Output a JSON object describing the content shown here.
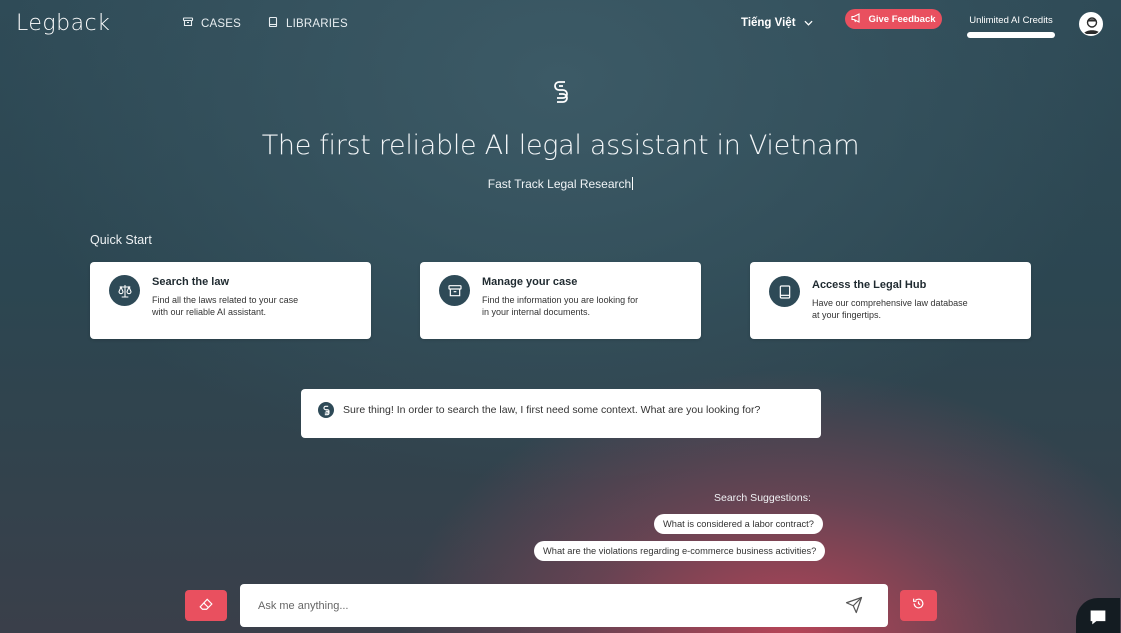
{
  "header": {
    "logo_text": "Legback",
    "nav": [
      {
        "label": "CASES",
        "icon": "archive-icon"
      },
      {
        "label": "LIBRARIES",
        "icon": "book-icon"
      }
    ],
    "language": "Tiếng Việt",
    "feedback_label": "Give Feedback",
    "credits_label": "Unlimited AI Credits",
    "credits_level": 1.0
  },
  "hero": {
    "title": "The first reliable AI legal assistant in Vietnam",
    "subtitle": "Fast Track Legal Research"
  },
  "quick_start": {
    "label": "Quick Start",
    "cards": [
      {
        "title": "Search the law",
        "desc1": "Find all the laws related to your case",
        "desc2": "with our reliable AI assistant.",
        "icon": "scale-icon"
      },
      {
        "title": "Manage your case",
        "desc1": "Find the information you are looking for",
        "desc2": "in your internal documents.",
        "icon": "archive-icon"
      },
      {
        "title": "Access the Legal Hub",
        "desc1": "Have our comprehensive law database",
        "desc2": "at your fingertips.",
        "icon": "book-icon"
      }
    ]
  },
  "chat": {
    "bot_message": "Sure thing! In order to search the law, I first need some context. What are you looking for?"
  },
  "suggestions": {
    "label": "Search Suggestions:",
    "items": [
      "What is considered a labor contract?",
      "What are the violations regarding e-commerce business activities?"
    ]
  },
  "input": {
    "placeholder": "Ask me anything..."
  },
  "colors": {
    "accent": "#e9505f",
    "dark_teal": "#2e4a57"
  }
}
